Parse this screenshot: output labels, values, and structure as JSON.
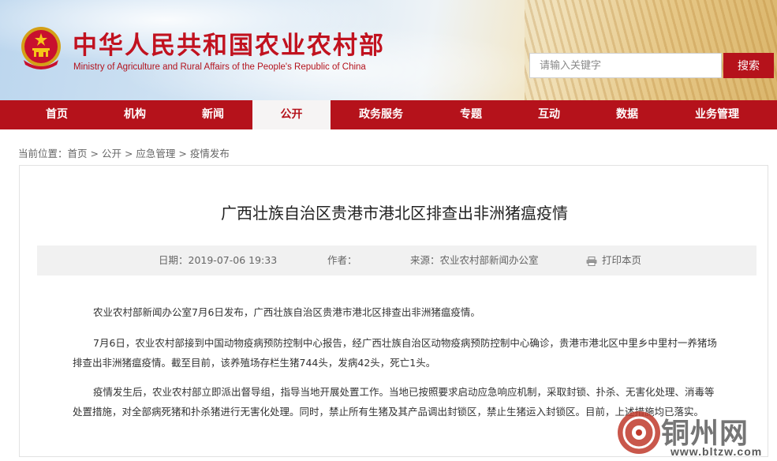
{
  "header": {
    "title": "中华人民共和国农业农村部",
    "subtitle": "Ministry of Agriculture and Rural Affairs of the People's Republic of China",
    "emblem_icon": "national-emblem-icon"
  },
  "search": {
    "placeholder": "请输入关键字",
    "button_label": "搜索"
  },
  "nav": {
    "items": [
      {
        "label": "首页"
      },
      {
        "label": "机构"
      },
      {
        "label": "新闻"
      },
      {
        "label": "公开",
        "active": true
      },
      {
        "label": "政务服务"
      },
      {
        "label": "专题"
      },
      {
        "label": "互动"
      },
      {
        "label": "数据"
      },
      {
        "label": "业务管理"
      }
    ]
  },
  "breadcrumb": {
    "prefix": "当前位置：",
    "items": [
      "首页",
      "公开",
      "应急管理",
      "疫情发布"
    ],
    "separator": " > "
  },
  "article": {
    "title": "广西壮族自治区贵港市港北区排查出非洲猪瘟疫情",
    "date": "日期：2019-07-06 19:33",
    "author": "作者：",
    "source": "来源：农业农村部新闻办公室",
    "print_label": "打印本页",
    "paragraphs": [
      "农业农村部新闻办公室7月6日发布，广西壮族自治区贵港市港北区排查出非洲猪瘟疫情。",
      "7月6日，农业农村部接到中国动物疫病预防控制中心报告，经广西壮族自治区动物疫病预防控制中心确诊，贵港市港北区中里乡中里村一养猪场排查出非洲猪瘟疫情。截至目前，该养殖场存栏生猪744头，发病42头，死亡1头。",
      "疫情发生后，农业农村部立即派出督导组，指导当地开展处置工作。当地已按照要求启动应急响应机制，采取封锁、扑杀、无害化处理、消毒等处置措施，对全部病死猪和扑杀猪进行无害化处理。同时，禁止所有生猪及其产品调出封锁区，禁止生猪运入封锁区。目前，上述措施均已落实。"
    ]
  },
  "watermark": {
    "text": "铜州网",
    "url": "www.bltzw.com"
  },
  "colors": {
    "brand_red": "#b5121b",
    "nav_active_bg": "#f6f4f4",
    "meta_bg": "#f1f1f1"
  }
}
